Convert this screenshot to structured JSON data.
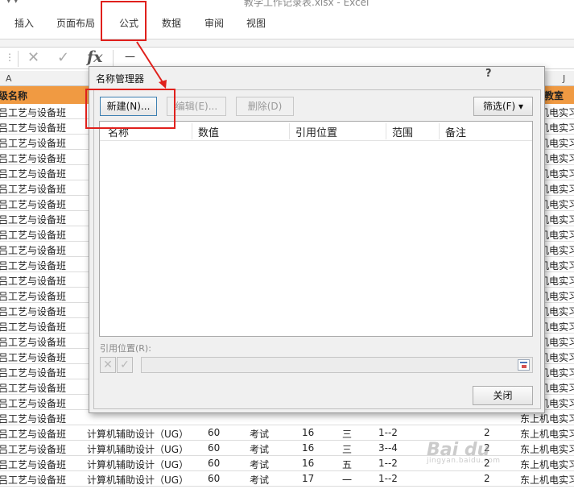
{
  "window": {
    "title": "教学工作记录表.xlsx - Excel"
  },
  "ribbon": {
    "tabs": [
      {
        "label": "插入"
      },
      {
        "label": "页面布局"
      },
      {
        "label": "公式"
      },
      {
        "label": "数据"
      },
      {
        "label": "审阅"
      },
      {
        "label": "视图"
      }
    ]
  },
  "formula_bar": {
    "value": "—"
  },
  "sheet": {
    "columns": [
      "A",
      "J"
    ],
    "header_row": {
      "class_name": "级名称",
      "classroom": "教室"
    },
    "rows": [
      {
        "class_name": "吕工艺与设备班",
        "course": "",
        "hours": "",
        "exam": "",
        "weeks": "",
        "day": "",
        "period": "",
        "count": "",
        "room": "东上机电实习"
      },
      {
        "class_name": "吕工艺与设备班",
        "course": "",
        "hours": "",
        "exam": "",
        "weeks": "",
        "day": "",
        "period": "",
        "count": "",
        "room": "东上机电实习"
      },
      {
        "class_name": "吕工艺与设备班",
        "course": "",
        "hours": "",
        "exam": "",
        "weeks": "",
        "day": "",
        "period": "",
        "count": "",
        "room": "东上机电实习"
      },
      {
        "class_name": "吕工艺与设备班",
        "course": "",
        "hours": "",
        "exam": "",
        "weeks": "",
        "day": "",
        "period": "",
        "count": "",
        "room": "东上机电实习"
      },
      {
        "class_name": "吕工艺与设备班",
        "course": "",
        "hours": "",
        "exam": "",
        "weeks": "",
        "day": "",
        "period": "",
        "count": "",
        "room": "东上机电实习"
      },
      {
        "class_name": "吕工艺与设备班",
        "course": "",
        "hours": "",
        "exam": "",
        "weeks": "",
        "day": "",
        "period": "",
        "count": "",
        "room": "东上机电实习"
      },
      {
        "class_name": "吕工艺与设备班",
        "course": "",
        "hours": "",
        "exam": "",
        "weeks": "",
        "day": "",
        "period": "",
        "count": "",
        "room": "东上机电实习"
      },
      {
        "class_name": "吕工艺与设备班",
        "course": "",
        "hours": "",
        "exam": "",
        "weeks": "",
        "day": "",
        "period": "",
        "count": "",
        "room": "东上机电实习"
      },
      {
        "class_name": "吕工艺与设备班",
        "course": "",
        "hours": "",
        "exam": "",
        "weeks": "",
        "day": "",
        "period": "",
        "count": "",
        "room": "东上机电实习"
      },
      {
        "class_name": "吕工艺与设备班",
        "course": "",
        "hours": "",
        "exam": "",
        "weeks": "",
        "day": "",
        "period": "",
        "count": "",
        "room": "东上机电实习"
      },
      {
        "class_name": "吕工艺与设备班",
        "course": "",
        "hours": "",
        "exam": "",
        "weeks": "",
        "day": "",
        "period": "",
        "count": "",
        "room": "东上机电实习"
      },
      {
        "class_name": "吕工艺与设备班",
        "course": "",
        "hours": "",
        "exam": "",
        "weeks": "",
        "day": "",
        "period": "",
        "count": "",
        "room": "东上机电实习"
      },
      {
        "class_name": "吕工艺与设备班",
        "course": "",
        "hours": "",
        "exam": "",
        "weeks": "",
        "day": "",
        "period": "",
        "count": "",
        "room": "东上机电实习"
      },
      {
        "class_name": "吕工艺与设备班",
        "course": "",
        "hours": "",
        "exam": "",
        "weeks": "",
        "day": "",
        "period": "",
        "count": "",
        "room": "东上机电实习"
      },
      {
        "class_name": "吕工艺与设备班",
        "course": "",
        "hours": "",
        "exam": "",
        "weeks": "",
        "day": "",
        "period": "",
        "count": "",
        "room": "东上机电实习"
      },
      {
        "class_name": "吕工艺与设备班",
        "course": "",
        "hours": "",
        "exam": "",
        "weeks": "",
        "day": "",
        "period": "",
        "count": "",
        "room": "东上机电实习"
      },
      {
        "class_name": "吕工艺与设备班",
        "course": "",
        "hours": "",
        "exam": "",
        "weeks": "",
        "day": "",
        "period": "",
        "count": "",
        "room": "东上机电实习"
      },
      {
        "class_name": "吕工艺与设备班",
        "course": "",
        "hours": "",
        "exam": "",
        "weeks": "",
        "day": "",
        "period": "",
        "count": "",
        "room": "东上机电实习"
      },
      {
        "class_name": "吕工艺与设备班",
        "course": "",
        "hours": "",
        "exam": "",
        "weeks": "",
        "day": "",
        "period": "",
        "count": "",
        "room": "东上机电实习"
      },
      {
        "class_name": "吕工艺与设备班",
        "course": "",
        "hours": "",
        "exam": "",
        "weeks": "",
        "day": "",
        "period": "",
        "count": "",
        "room": "东上机电实习"
      },
      {
        "class_name": "吕工艺与设备班",
        "course": "",
        "hours": "",
        "exam": "",
        "weeks": "",
        "day": "",
        "period": "",
        "count": "",
        "room": "东上机电实习"
      },
      {
        "class_name": "吕工艺与设备班",
        "course": "计算机辅助设计（UG）",
        "hours": "60",
        "exam": "考试",
        "weeks": "16",
        "day": "三",
        "period": "1--2",
        "count": "2",
        "room": "东上机电实习"
      },
      {
        "class_name": "吕工艺与设备班",
        "course": "计算机辅助设计（UG）",
        "hours": "60",
        "exam": "考试",
        "weeks": "16",
        "day": "三",
        "period": "3--4",
        "count": "2",
        "room": "东上机电实习"
      },
      {
        "class_name": "吕工艺与设备班",
        "course": "计算机辅助设计（UG）",
        "hours": "60",
        "exam": "考试",
        "weeks": "16",
        "day": "五",
        "period": "1--2",
        "count": "2",
        "room": "东上机电实习"
      },
      {
        "class_name": "吕工艺与设备班",
        "course": "计算机辅助设计（UG）",
        "hours": "60",
        "exam": "考试",
        "weeks": "17",
        "day": "一",
        "period": "1--2",
        "count": "2",
        "room": "东上机电实习"
      }
    ]
  },
  "dialog": {
    "title": "名称管理器",
    "help": "?",
    "buttons": {
      "new": "新建(N)...",
      "edit": "编辑(E)...",
      "delete": "删除(D)",
      "filter": "筛选(F) ▾",
      "close": "关闭"
    },
    "list_columns": [
      "名称",
      "数值",
      "引用位置",
      "范围",
      "备注"
    ],
    "refers_to_label": "引用位置(R):",
    "refers_to_value": ""
  },
  "watermark": {
    "text": "Bai du",
    "sub": "jingyan.baidu.com"
  }
}
